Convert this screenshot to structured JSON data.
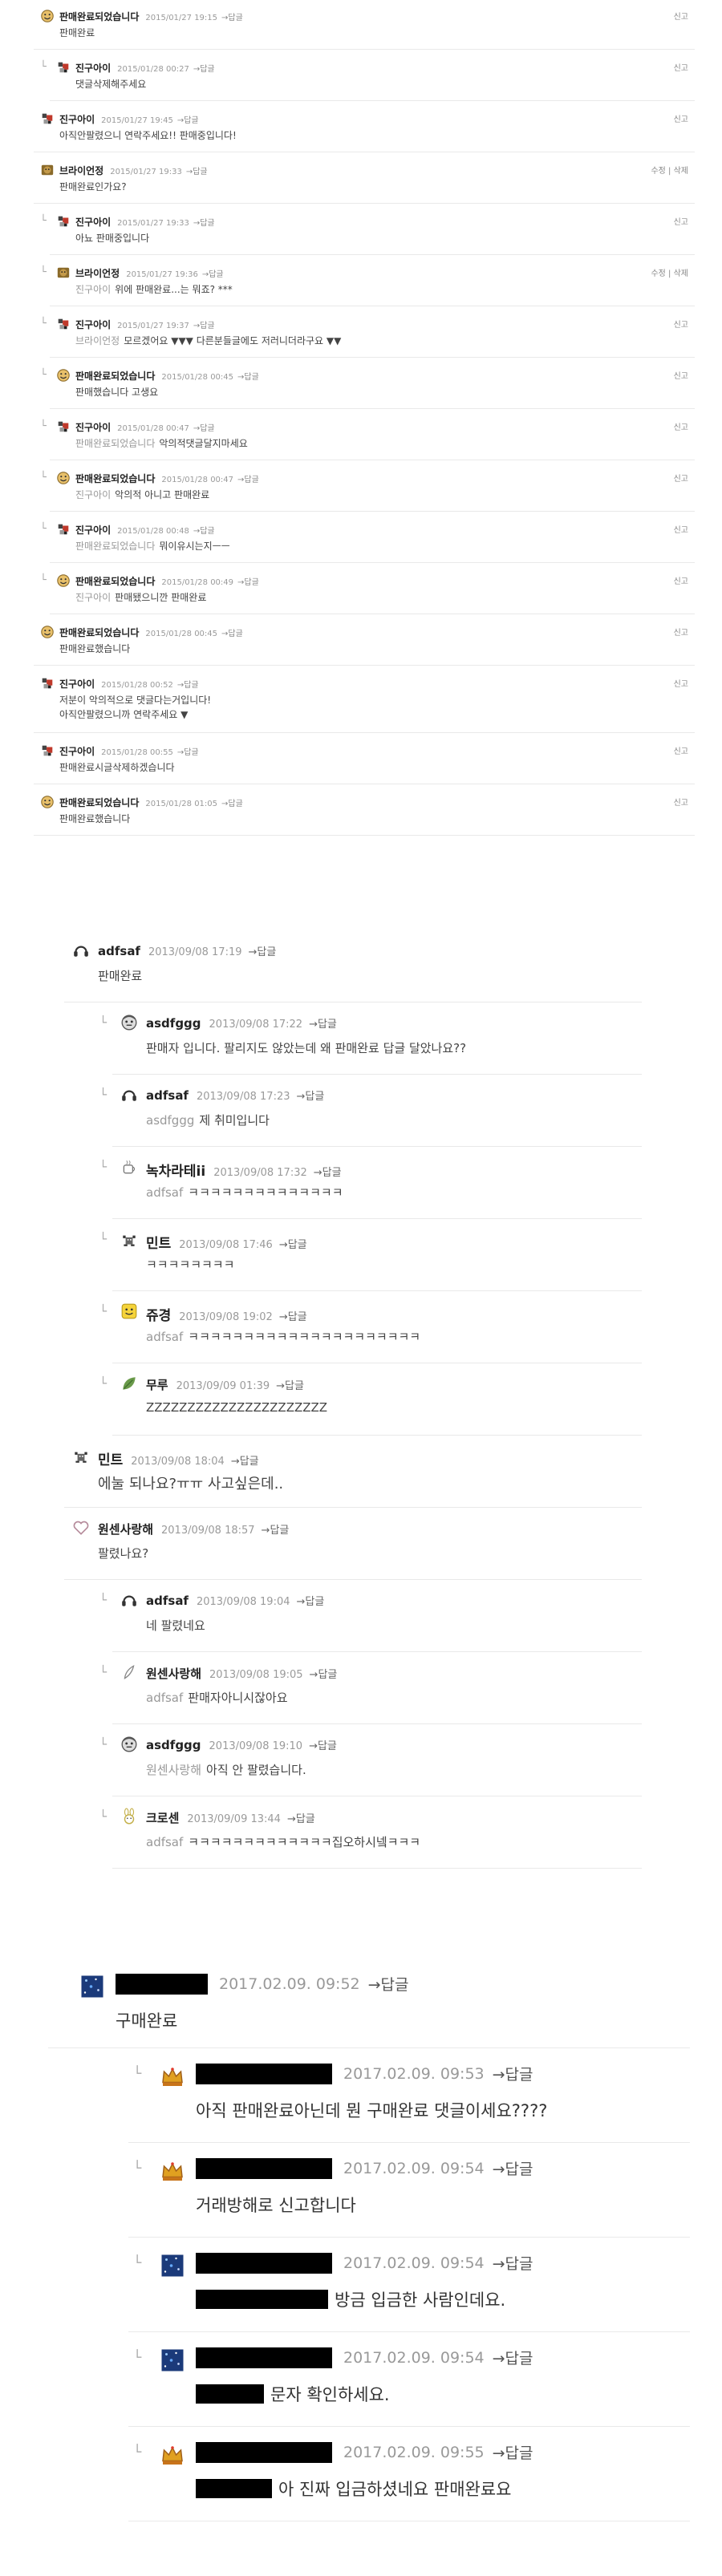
{
  "thread1": [
    {
      "name": "판매완료되었습니다",
      "date": "2015/01/27 19:15",
      "reply": "→답글",
      "report": "신고",
      "text": "판매완료",
      "icon": "smiley-icon"
    },
    {
      "name": "진구아이",
      "date": "2015/01/28 00:27",
      "reply": "→답글",
      "report": "신고",
      "text": "댓글삭제해주세요",
      "icon": "pixel-avatar-icon"
    },
    {
      "name": "진구아이",
      "date": "2015/01/27 19:45",
      "reply": "→답글",
      "report": "신고",
      "text": "아직안팔렸으니 연락주세요!! 판매중입니다!",
      "icon": "pixel-avatar-icon"
    },
    {
      "name": "브라이언정",
      "date": "2015/01/27 19:33",
      "reply": "→답글",
      "report": "수정 | 삭제",
      "text": "판매완료인가요?",
      "icon": "bear-icon"
    },
    {
      "name": "진구아이",
      "date": "2015/01/27 19:33",
      "reply": "→답글",
      "report": "신고",
      "text": "아뇨 판매중입니다",
      "icon": "pixel-avatar-icon"
    },
    {
      "name": "브라이언정",
      "date": "2015/01/27 19:36",
      "reply": "→답글",
      "report": "수정 | 삭제",
      "mention": "진구아이",
      "text": "위에 판매완료...는 뭐죠? ***",
      "icon": "bear-icon"
    },
    {
      "name": "진구아이",
      "date": "2015/01/27 19:37",
      "reply": "→답글",
      "report": "신고",
      "mention": "브라이언정",
      "text": "모르겠어요 ▼▼▼ 다른분들글에도 저러니더라구요 ▼▼",
      "icon": "pixel-avatar-icon"
    },
    {
      "name": "판매완료되었습니다",
      "date": "2015/01/28 00:45",
      "reply": "→답글",
      "report": "신고",
      "text": "판매했습니다 고생요",
      "icon": "smiley-icon"
    },
    {
      "name": "진구아이",
      "date": "2015/01/28 00:47",
      "reply": "→답글",
      "report": "신고",
      "mention": "판매완료되었습니다",
      "text": "악의적댓글달지마세요",
      "icon": "pixel-avatar-icon"
    },
    {
      "name": "판매완료되었습니다",
      "date": "2015/01/28 00:47",
      "reply": "→답글",
      "report": "신고",
      "mention": "진구아이",
      "text": "악의적 아니고 판매완료",
      "icon": "smiley-icon"
    },
    {
      "name": "진구아이",
      "date": "2015/01/28 00:48",
      "reply": "→답글",
      "report": "신고",
      "mention": "판매완료되었습니다",
      "text": "뭐이유시는지ㅡㅡ",
      "icon": "pixel-avatar-icon"
    },
    {
      "name": "판매완료되었습니다",
      "date": "2015/01/28 00:49",
      "reply": "→답글",
      "report": "신고",
      "mention": "진구아이",
      "text": "판매됐으니깐 판매완료",
      "icon": "smiley-icon"
    },
    {
      "name": "판매완료되었습니다",
      "date": "2015/01/28 00:45",
      "reply": "→답글",
      "report": "신고",
      "text": "판매완료했습니다",
      "icon": "smiley-icon"
    },
    {
      "name": "진구아이",
      "date": "2015/01/28 00:52",
      "reply": "→답글",
      "report": "신고",
      "text": "저분이 악의적으로 댓글다는거입니다!",
      "text2": "아직안팔렸으니까 연락주세요 ▼",
      "icon": "pixel-avatar-icon"
    },
    {
      "name": "진구아이",
      "date": "2015/01/28 00:55",
      "reply": "→답글",
      "report": "신고",
      "text": "판매완료시글삭제하겠습니다",
      "icon": "pixel-avatar-icon"
    },
    {
      "name": "판매완료되었습니다",
      "date": "2015/01/28 01:05",
      "reply": "→답글",
      "report": "신고",
      "text": "판매완료했습니다",
      "icon": "smiley-icon"
    }
  ],
  "thread2": [
    {
      "name": "adfsaf",
      "date": "2013/09/08 17:19",
      "reply": "→답글",
      "text": "판매완료",
      "icon": "headphones-icon"
    },
    {
      "name": "asdfggg",
      "date": "2013/09/08 17:22",
      "reply": "→답글",
      "text": "판매자 입니다. 팔리지도 않았는데 왜 판매완료 답글 달았나요??",
      "icon": "face-avatar-icon"
    },
    {
      "name": "adfsaf",
      "date": "2013/09/08 17:23",
      "reply": "→답글",
      "mention": "asdfggg",
      "text": "제 취미입니다",
      "icon": "headphones-icon"
    },
    {
      "name": "녹차라테ii",
      "date": "2013/09/08 17:32",
      "reply": "→답글",
      "mention": "adfsaf",
      "text": "ㅋㅋㅋㅋㅋㅋㅋㅋㅋㅋㅋㅋㅋㅋ",
      "icon": "tea-icon"
    },
    {
      "name": "민트",
      "date": "2013/09/08 17:46",
      "reply": "→답글",
      "text": "ㅋㅋㅋㅋㅋㅋㅋㅋ",
      "icon": "sprite-icon"
    },
    {
      "name": "쥬경",
      "date": "2013/09/08 19:02",
      "reply": "→답글",
      "mention": "adfsaf",
      "text": "ㅋㅋㅋㅋㅋㅋㅋㅋㅋㅋㅋㅋㅋㅋㅋㅋㅋㅋㅋㅋㅋ",
      "icon": "yellow-face-icon"
    },
    {
      "name": "무루",
      "date": "2013/09/09 01:39",
      "reply": "→답글",
      "text": "ZZZZZZZZZZZZZZZZZZZZZZ",
      "icon": "leaf-icon"
    },
    {
      "name": "민트",
      "date": "2013/09/08 18:04",
      "reply": "→답글",
      "text": "에눌 되나요?ㅠㅠ 사고싶은데..",
      "icon": "sprite-icon"
    },
    {
      "name": "원센사랑해",
      "date": "2013/09/08 18:57",
      "reply": "→답글",
      "text": "팔렸나요?",
      "icon": "heart-icon"
    },
    {
      "name": "adfsaf",
      "date": "2013/09/08 19:04",
      "reply": "→답글",
      "text": "네 팔렸네요",
      "icon": "headphones-icon"
    },
    {
      "name": "원센사랑해",
      "date": "2013/09/08 19:05",
      "reply": "→답글",
      "mention": "adfsaf",
      "text": "판매자아니시잖아요",
      "icon": "feather-icon"
    },
    {
      "name": "asdfggg",
      "date": "2013/09/08 19:10",
      "reply": "→답글",
      "mention": "원센사랑해",
      "text": "아직 안 팔렸습니다.",
      "icon": "face-avatar-icon"
    },
    {
      "name": "크로센",
      "date": "2013/09/09 13:44",
      "reply": "→답글",
      "mention": "adfsaf",
      "text": "ㅋㅋㅋㅋㅋㅋㅋㅋㅋㅋㅋㅋㅋ집오하시넼ㅋㅋㅋ",
      "icon": "bunny-icon"
    }
  ],
  "thread3": [
    {
      "date": "2017.02.09. 09:52",
      "reply": "→답글",
      "text": "구매완료",
      "icon": "starry-icon"
    },
    {
      "date": "2017.02.09. 09:53",
      "reply": "→답글",
      "text": "아직 판매완료아닌데 뭔 구매완료 댓글이세요????",
      "icon": "crown-icon"
    },
    {
      "date": "2017.02.09. 09:54",
      "reply": "→답글",
      "text": "거래방해로 신고합니다",
      "icon": "crown-icon"
    },
    {
      "date": "2017.02.09. 09:54",
      "reply": "→답글",
      "text": "방금 입금한 사람인데요.",
      "icon": "starry-icon"
    },
    {
      "date": "2017.02.09. 09:54",
      "reply": "→답글",
      "text": "문자 확인하세요.",
      "icon": "starry-icon"
    },
    {
      "date": "2017.02.09. 09:55",
      "reply": "→답글",
      "text": "아 진짜 입금하셨네요 판매완료요",
      "icon": "crown-icon"
    }
  ]
}
